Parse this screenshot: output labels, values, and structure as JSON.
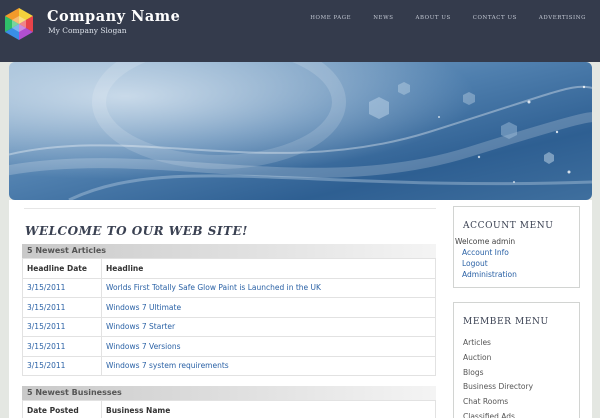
{
  "brand": {
    "name": "Company Name",
    "slogan": "My Company Slogan"
  },
  "nav": [
    {
      "label": "Home Page"
    },
    {
      "label": "News"
    },
    {
      "label": "About Us"
    },
    {
      "label": "Contact Us"
    },
    {
      "label": "Advertising"
    }
  ],
  "main": {
    "title": "Welcome to our web site!",
    "articles": {
      "header": "5 Newest Articles",
      "columns": [
        "Headline Date",
        "Headline"
      ],
      "rows": [
        {
          "date": "3/15/2011",
          "headline": "Worlds First Totally Safe Glow Paint is Launched in the UK"
        },
        {
          "date": "3/15/2011",
          "headline": "Windows 7 Ultimate"
        },
        {
          "date": "3/15/2011",
          "headline": "Windows 7 Starter"
        },
        {
          "date": "3/15/2011",
          "headline": "Windows 7 Versions"
        },
        {
          "date": "3/15/2011",
          "headline": "Windows 7 system requirements"
        }
      ]
    },
    "businesses": {
      "header": "5 Newest Businesses",
      "columns": [
        "Date Posted",
        "Business Name"
      ]
    }
  },
  "account_menu": {
    "title": "Account Menu",
    "welcome": "Welcome admin",
    "links": [
      {
        "label": "Account Info"
      },
      {
        "label": "Logout"
      },
      {
        "label": "Administration"
      }
    ]
  },
  "member_menu": {
    "title": "Member Menu",
    "links": [
      {
        "label": "Articles"
      },
      {
        "label": "Auction"
      },
      {
        "label": "Blogs"
      },
      {
        "label": "Business Directory"
      },
      {
        "label": "Chat Rooms"
      },
      {
        "label": "Classified Ads"
      }
    ]
  },
  "colors": {
    "header_bg": "#343b4c",
    "link": "#2b62a6",
    "page_bg": "#e4e7e2"
  }
}
